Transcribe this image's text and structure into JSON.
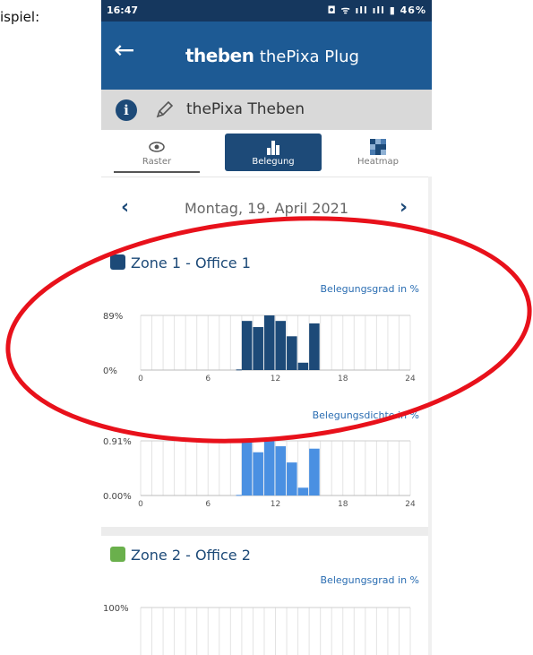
{
  "caption": "ispiel:",
  "status_bar": {
    "time": "16:47",
    "icons_text": "◘ ᯤ ıll ıll ▮ 46%"
  },
  "app_bar": {
    "back_icon": "arrow-left-icon",
    "brand": "theben",
    "product": "thePixa Plug"
  },
  "device_bar": {
    "info_icon": "i",
    "name": "thePixa Theben"
  },
  "tabs": [
    {
      "label": "Raster",
      "icon": "eye-icon"
    },
    {
      "label": "Belegung",
      "icon": "bar-chart-icon",
      "selected": true
    },
    {
      "label": "Heatmap",
      "icon": "heatmap-icon"
    }
  ],
  "date_bar": {
    "prev": "‹",
    "next": "›",
    "date": "Montag, 19. April 2021"
  },
  "zones": [
    {
      "title": "Zone 1 - Office 1",
      "color": "#1d4a78"
    },
    {
      "title": "Zone 2 - Office 2",
      "color": "#6ab04c"
    }
  ],
  "chart_data": [
    {
      "type": "bar",
      "title": "Belegungsgrad in %",
      "x_ticks": [
        "0",
        "6",
        "12",
        "18",
        "24"
      ],
      "y_ticks": [
        "89%",
        "0%"
      ],
      "xlim": [
        0,
        24
      ],
      "ylim": [
        0,
        89
      ],
      "color": "#1d4a78",
      "bars": [
        {
          "x": 8.5,
          "value": 1
        },
        {
          "x": 9,
          "value": 80
        },
        {
          "x": 10,
          "value": 70
        },
        {
          "x": 11,
          "value": 89
        },
        {
          "x": 12,
          "value": 80
        },
        {
          "x": 13,
          "value": 55
        },
        {
          "x": 14,
          "value": 12
        },
        {
          "x": 15,
          "value": 76
        }
      ]
    },
    {
      "type": "bar",
      "title": "Belegungsdichte in %",
      "x_ticks": [
        "0",
        "6",
        "12",
        "18",
        "24"
      ],
      "y_ticks": [
        "0.91%",
        "0.00%"
      ],
      "xlim": [
        0,
        24
      ],
      "ylim": [
        0,
        0.91
      ],
      "color": "#4a90e2",
      "bars": [
        {
          "x": 8.5,
          "value": 0.01
        },
        {
          "x": 9,
          "value": 0.9
        },
        {
          "x": 10,
          "value": 0.72
        },
        {
          "x": 11,
          "value": 0.91
        },
        {
          "x": 12,
          "value": 0.82
        },
        {
          "x": 13,
          "value": 0.55
        },
        {
          "x": 14,
          "value": 0.13
        },
        {
          "x": 15,
          "value": 0.78
        }
      ]
    },
    {
      "type": "bar",
      "title": "Belegungsgrad in %",
      "x_ticks": [],
      "y_ticks": [
        "100%"
      ],
      "xlim": [
        0,
        24
      ],
      "ylim": [
        0,
        100
      ],
      "color": "#6ab04c",
      "bars": []
    }
  ]
}
